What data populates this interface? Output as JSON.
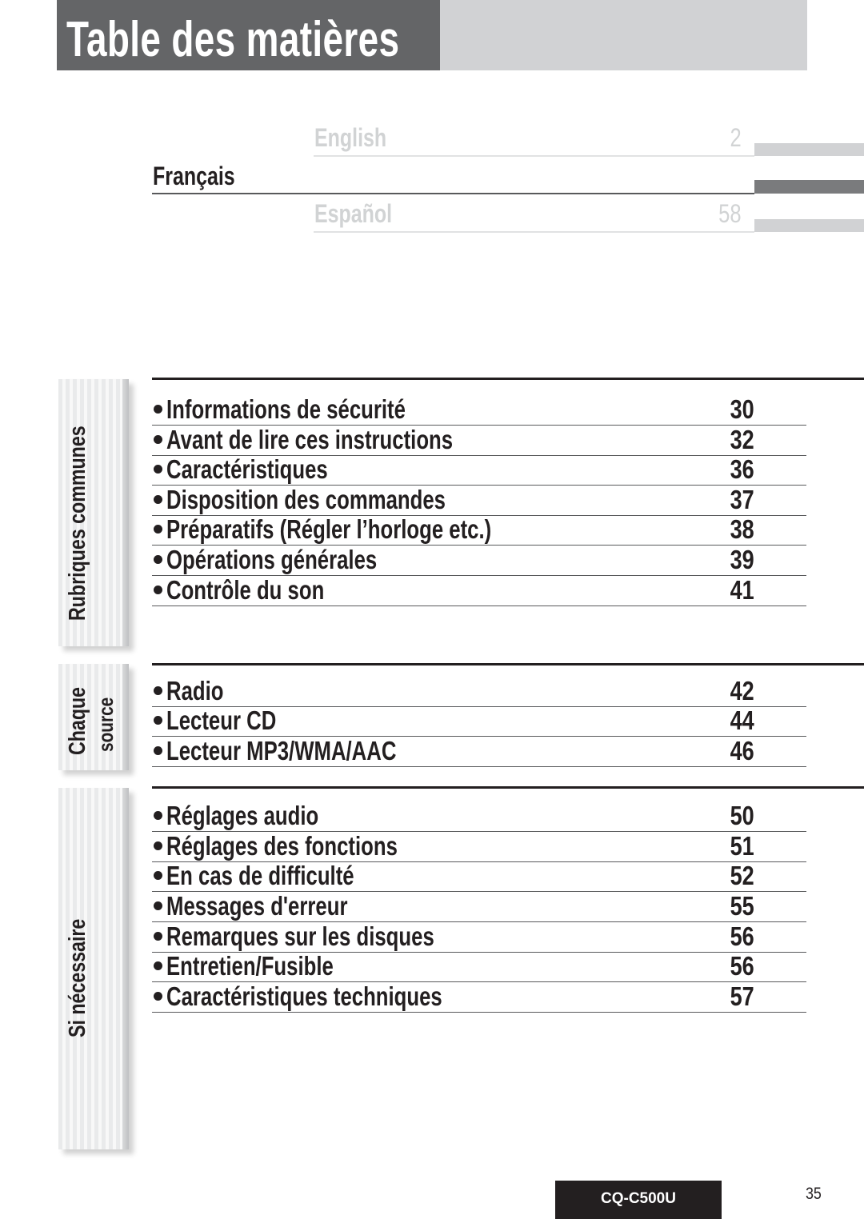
{
  "header": {
    "title": "Table des matières"
  },
  "languages": [
    {
      "label": "English",
      "page": "2",
      "state": "inactive"
    },
    {
      "label": "Français",
      "page": "",
      "state": "active"
    },
    {
      "label": "Español",
      "page": "58",
      "state": "inactive"
    }
  ],
  "sections": [
    {
      "tab_label_lines": [
        "Rubriques communes"
      ],
      "items": [
        {
          "title": "Informations de sécurité",
          "page": "30"
        },
        {
          "title": "Avant de lire ces instructions",
          "page": "32"
        },
        {
          "title": "Caractéristiques",
          "page": "36"
        },
        {
          "title": "Disposition des commandes",
          "page": "37"
        },
        {
          "title": "Préparatifs (Régler l’horloge etc.)",
          "page": "38"
        },
        {
          "title": "Opérations générales",
          "page": "39"
        },
        {
          "title": "Contrôle du son",
          "page": "41"
        }
      ]
    },
    {
      "tab_label_lines": [
        "Chaque",
        "source"
      ],
      "items": [
        {
          "title": "Radio",
          "page": "42"
        },
        {
          "title": "Lecteur CD",
          "page": "44"
        },
        {
          "title": "Lecteur MP3/WMA/AAC",
          "page": "46"
        }
      ]
    },
    {
      "tab_label_lines": [
        "Si nécessaire"
      ],
      "items": [
        {
          "title": "Réglages audio",
          "page": "50"
        },
        {
          "title": "Réglages des fonctions",
          "page": "51"
        },
        {
          "title": "En cas de difficulté",
          "page": "52"
        },
        {
          "title": "Messages d'erreur",
          "page": "55"
        },
        {
          "title": "Remarques sur les disques",
          "page": "56"
        },
        {
          "title": "Entretien/Fusible",
          "page": "56"
        },
        {
          "title": "Caractéristiques techniques",
          "page": "57"
        }
      ]
    }
  ],
  "footer": {
    "model": "CQ-C500U",
    "page_number": "35"
  },
  "colors": {
    "title_bar": "#646567",
    "title_bar_light": "#d1d2d4",
    "text": "#231f20",
    "inactive_language": "#d1d3d4",
    "active_language_tab": "#7a7b7d"
  }
}
